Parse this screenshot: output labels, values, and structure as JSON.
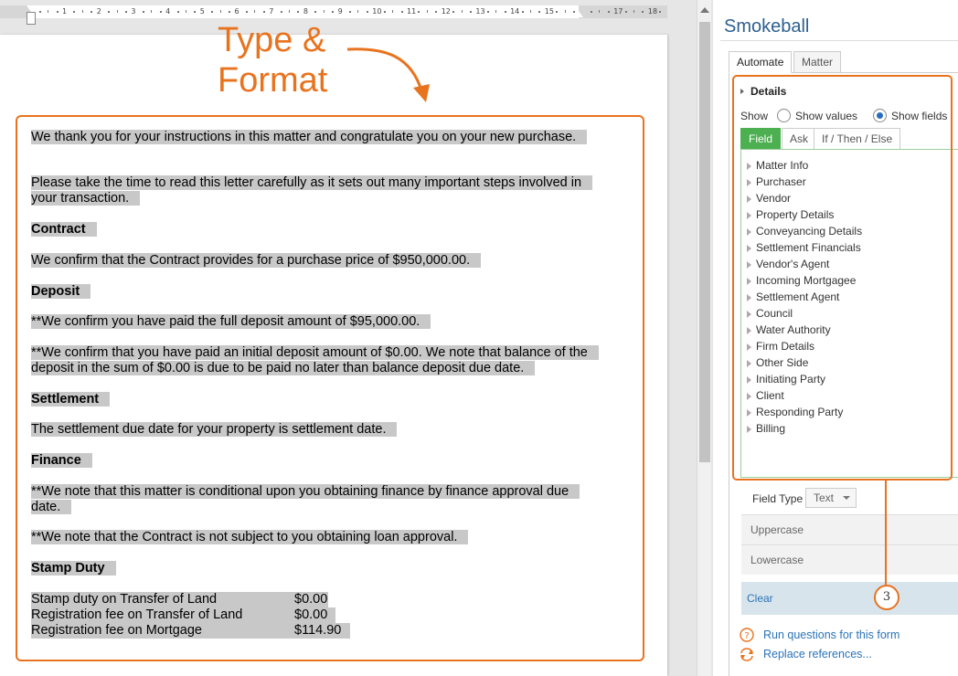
{
  "annotation": {
    "title_line1": "Type &",
    "title_line2": "Format",
    "badge": "3"
  },
  "ruler": {
    "numbers": [
      "1",
      "2",
      "3",
      "4",
      "5",
      "6",
      "7",
      "8",
      "9",
      "10",
      "11",
      "12",
      "13",
      "14",
      "15",
      "17",
      "18"
    ]
  },
  "document": {
    "p1": "We thank you for your instructions in this matter and congratulate you on your new purchase.",
    "p2": "Please take the time to read this letter carefully as it sets out many important steps involved in your transaction.",
    "h_contract": "Contract",
    "p3": "We confirm that the Contract provides for a purchase price of $950,000.00.",
    "h_deposit": "Deposit",
    "p4": "**We confirm you have paid the full deposit amount of $95,000.00.",
    "p5": "**We confirm that you have paid an initial deposit amount of $0.00. We note that balance of the deposit in the sum of $0.00 is due to be paid no later than balance deposit due date.",
    "h_settlement": "Settlement",
    "p6": "The settlement due date for your property is settlement date.",
    "h_finance": "Finance",
    "p7": "**We note that this matter is conditional upon you obtaining finance by finance approval due date.",
    "p8": "**We note that the Contract is not subject to you obtaining loan approval.",
    "h_stamp": "Stamp Duty",
    "table": [
      {
        "label": "Stamp duty on Transfer of Land",
        "value": "$0.00"
      },
      {
        "label": "Registration fee on Transfer of Land",
        "value": "$0.00"
      },
      {
        "label": "Registration fee on Mortgage",
        "value": "$114.90"
      }
    ]
  },
  "panel": {
    "title": "Smokeball",
    "tabs": [
      "Automate",
      "Matter"
    ],
    "details_label": "Details",
    "show_label": "Show",
    "radio_values": "Show values",
    "radio_fields": "Show fields",
    "radio_selected": "Show fields",
    "subtabs": [
      "Field",
      "Ask",
      "If / Then / Else"
    ],
    "tree": [
      "Matter Info",
      "Purchaser",
      "Vendor",
      "Property Details",
      "Conveyancing Details",
      "Settlement Financials",
      "Vendor's Agent",
      "Incoming Mortgagee",
      "Settlement Agent",
      "Council",
      "Water Authority",
      "Firm Details",
      "Other Side",
      "Initiating Party",
      "Client",
      "Responding Party",
      "Billing"
    ],
    "field_type_label": "Field Type",
    "field_type_value": "Text",
    "btn_uppercase": "Uppercase",
    "btn_lowercase": "Lowercase",
    "btn_clear": "Clear",
    "link_run": "Run questions for this form",
    "link_replace": "Replace references...",
    "colors": {
      "accent": "#e8731f",
      "field_tab": "#4caf50",
      "link": "#2a73b8",
      "title": "#2d5f8f",
      "highlight": "#c8c8c8"
    }
  }
}
